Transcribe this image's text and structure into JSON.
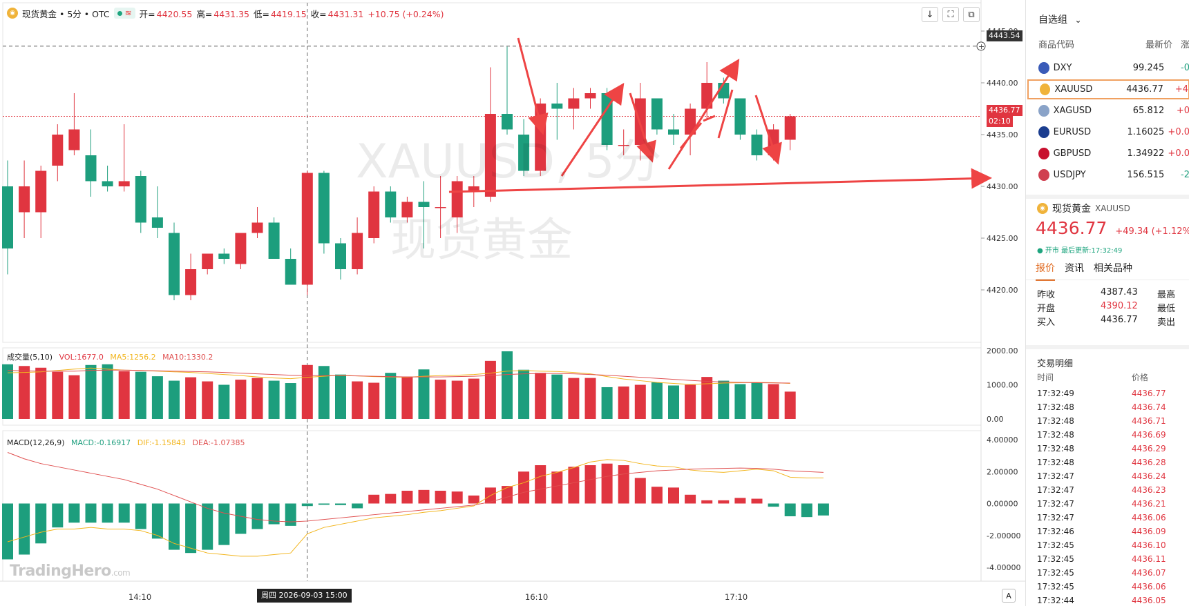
{
  "header": {
    "symbol_title": "现货黄金 • 5分 • OTC",
    "coin_icon": "coin-icon",
    "open_label": "开=",
    "open": "4420.55",
    "high_label": "高=",
    "high": "4431.35",
    "low_label": "低=",
    "low": "4419.15",
    "close_label": "收=",
    "close": "4431.31",
    "change": "+10.75 (+0.24%)"
  },
  "toolbar": {
    "download_icon": "↓",
    "fullscreen_icon": "⛶",
    "screenshot_icon": "⧉"
  },
  "watermark": {
    "symbol": "XAUUSD, 5分",
    "name": "现货黄金",
    "brand": "TradingHero",
    "brand_suffix": ".com"
  },
  "price_axis": {
    "ticks": [
      "4445.00",
      "4440.00",
      "4435.00",
      "4430.00",
      "4425.00",
      "4420.00"
    ],
    "crosshair_value": "4443.54",
    "last_price": "4436.77",
    "countdown": "02:10"
  },
  "volume_pane": {
    "label": "成交量(5,10)",
    "vol": "VOL:1677.0",
    "ma5": "MA5:1256.2",
    "ma10": "MA10:1330.2",
    "ticks": [
      "2000.00",
      "1000.00",
      "0.00"
    ]
  },
  "macd_pane": {
    "label": "MACD(12,26,9)",
    "macd": "MACD:-0.16917",
    "dif": "DIF:-1.15843",
    "dea": "DEA:-1.07385",
    "ticks": [
      "4.00000",
      "2.00000",
      "0.00000",
      "-2.00000",
      "-4.00000"
    ]
  },
  "time_axis": {
    "labels": [
      "14:10",
      "16:10",
      "17:10"
    ],
    "crosshair_date": "周四 2026-09-03  15:00",
    "auto_button": "A"
  },
  "colors": {
    "up": "#e03540",
    "down": "#1d9e7d",
    "ma5": "#f2b51d",
    "ma10": "#e05050",
    "arrow": "#ee4444"
  },
  "chart_data": [
    {
      "type": "candlestick",
      "title": "现货黄金 • 5分 • OTC",
      "ylim": [
        4418,
        4446
      ],
      "candles": [
        {
          "o": 4430.0,
          "h": 4432.5,
          "l": 4421.5,
          "c": 4424.0
        },
        {
          "o": 4427.5,
          "h": 4432.5,
          "l": 4425.0,
          "c": 4430.0
        },
        {
          "o": 4427.5,
          "h": 4432.0,
          "l": 4425.0,
          "c": 4431.5
        },
        {
          "o": 4432.0,
          "h": 4436.0,
          "l": 4430.5,
          "c": 4435.0
        },
        {
          "o": 4433.5,
          "h": 4439.0,
          "l": 4433.0,
          "c": 4435.5
        },
        {
          "o": 4433.0,
          "h": 4435.5,
          "l": 4429.0,
          "c": 4430.5
        },
        {
          "o": 4430.5,
          "h": 4432.0,
          "l": 4429.5,
          "c": 4430.0
        },
        {
          "o": 4430.0,
          "h": 4436.0,
          "l": 4429.5,
          "c": 4430.5
        },
        {
          "o": 4431.0,
          "h": 4431.5,
          "l": 4425.5,
          "c": 4426.5
        },
        {
          "o": 4427.0,
          "h": 4430.0,
          "l": 4425.0,
          "c": 4426.0
        },
        {
          "o": 4425.5,
          "h": 4426.5,
          "l": 4419.0,
          "c": 4419.5
        },
        {
          "o": 4419.5,
          "h": 4423.5,
          "l": 4419.0,
          "c": 4422.0
        },
        {
          "o": 4422.0,
          "h": 4423.5,
          "l": 4421.5,
          "c": 4423.5
        },
        {
          "o": 4423.5,
          "h": 4424.0,
          "l": 4422.5,
          "c": 4423.0
        },
        {
          "o": 4422.5,
          "h": 4425.5,
          "l": 4422.0,
          "c": 4425.5
        },
        {
          "o": 4425.5,
          "h": 4428.0,
          "l": 4425.0,
          "c": 4426.5
        },
        {
          "o": 4426.5,
          "h": 4427.0,
          "l": 4423.0,
          "c": 4423.0
        },
        {
          "o": 4423.0,
          "h": 4424.0,
          "l": 4420.5,
          "c": 4420.5
        },
        {
          "o": 4420.5,
          "h": 4431.5,
          "l": 4419.5,
          "c": 4431.3
        },
        {
          "o": 4431.3,
          "h": 4431.5,
          "l": 4423.5,
          "c": 4424.5
        },
        {
          "o": 4424.5,
          "h": 4425.0,
          "l": 4421.0,
          "c": 4422.0
        },
        {
          "o": 4422.0,
          "h": 4427.0,
          "l": 4421.5,
          "c": 4425.5
        },
        {
          "o": 4425.0,
          "h": 4430.0,
          "l": 4424.5,
          "c": 4429.5
        },
        {
          "o": 4429.5,
          "h": 4430.0,
          "l": 4426.5,
          "c": 4427.0
        },
        {
          "o": 4427.0,
          "h": 4429.0,
          "l": 4426.5,
          "c": 4428.5
        },
        {
          "o": 4428.5,
          "h": 4430.5,
          "l": 4424.0,
          "c": 4428.0
        },
        {
          "o": 4428.0,
          "h": 4431.0,
          "l": 4425.0,
          "c": 4428.0
        },
        {
          "o": 4427.0,
          "h": 4431.0,
          "l": 4425.5,
          "c": 4430.5
        },
        {
          "o": 4429.5,
          "h": 4431.0,
          "l": 4428.0,
          "c": 4430.0
        },
        {
          "o": 4429.0,
          "h": 4441.5,
          "l": 4428.5,
          "c": 4437.0
        },
        {
          "o": 4437.0,
          "h": 4443.5,
          "l": 4435.0,
          "c": 4435.5
        },
        {
          "o": 4435.0,
          "h": 4436.5,
          "l": 4431.0,
          "c": 4431.5
        },
        {
          "o": 4431.5,
          "h": 4438.5,
          "l": 4431.0,
          "c": 4438.0
        },
        {
          "o": 4438.0,
          "h": 4440.0,
          "l": 4434.5,
          "c": 4437.5
        },
        {
          "o": 4437.5,
          "h": 4439.5,
          "l": 4435.5,
          "c": 4438.5
        },
        {
          "o": 4438.5,
          "h": 4439.5,
          "l": 4437.5,
          "c": 4439.0
        },
        {
          "o": 4439.0,
          "h": 4439.5,
          "l": 4433.5,
          "c": 4434.0
        },
        {
          "o": 4434.0,
          "h": 4435.5,
          "l": 4433.0,
          "c": 4434.0
        },
        {
          "o": 4434.0,
          "h": 4440.0,
          "l": 4432.5,
          "c": 4438.5
        },
        {
          "o": 4438.5,
          "h": 4438.5,
          "l": 4435.0,
          "c": 4435.5
        },
        {
          "o": 4435.5,
          "h": 4437.0,
          "l": 4434.0,
          "c": 4435.0
        },
        {
          "o": 4435.0,
          "h": 4438.0,
          "l": 4433.0,
          "c": 4437.5
        },
        {
          "o": 4437.5,
          "h": 4442.0,
          "l": 4436.5,
          "c": 4440.0
        },
        {
          "o": 4440.0,
          "h": 4440.5,
          "l": 4438.0,
          "c": 4438.5
        },
        {
          "o": 4438.5,
          "h": 4438.5,
          "l": 4434.5,
          "c": 4435.0
        },
        {
          "o": 4435.0,
          "h": 4435.5,
          "l": 4432.5,
          "c": 4433.0
        },
        {
          "o": 4433.0,
          "h": 4436.0,
          "l": 4432.5,
          "c": 4435.5
        },
        {
          "o": 4434.5,
          "h": 4437.0,
          "l": 4433.5,
          "c": 4436.77
        }
      ]
    },
    {
      "type": "bar",
      "title": "成交量(5,10)",
      "ylim": [
        0,
        2000
      ],
      "values": [
        1600,
        1550,
        1500,
        1380,
        1280,
        1580,
        1600,
        1400,
        1380,
        1250,
        1120,
        1220,
        1100,
        1000,
        1150,
        1200,
        1120,
        1050,
        1580,
        1550,
        1300,
        1100,
        1060,
        1350,
        1240,
        1450,
        1150,
        1120,
        1180,
        1700,
        1980,
        1440,
        1350,
        1300,
        1200,
        1200,
        930,
        950,
        1000,
        1070,
        980,
        1000,
        1230,
        1120,
        1020,
        1070,
        1020,
        800
      ],
      "ma5": [
        1350,
        1360,
        1380,
        1420,
        1460,
        1490,
        1460,
        1430,
        1420,
        1400,
        1380,
        1360,
        1330,
        1300,
        1270,
        1230,
        1200,
        1180,
        1220,
        1250,
        1280,
        1260,
        1240,
        1230,
        1220,
        1250,
        1270,
        1280,
        1300,
        1340,
        1400,
        1420,
        1400,
        1390,
        1360,
        1320,
        1240,
        1170,
        1120,
        1070,
        1040,
        1010,
        1030,
        1050,
        1060,
        1070,
        1060,
        1040
      ],
      "ma10": [
        1420,
        1410,
        1400,
        1400,
        1400,
        1420,
        1430,
        1430,
        1420,
        1410,
        1400,
        1390,
        1380,
        1360,
        1340,
        1320,
        1300,
        1280,
        1270,
        1270,
        1270,
        1260,
        1250,
        1240,
        1230,
        1230,
        1230,
        1240,
        1250,
        1270,
        1300,
        1320,
        1330,
        1330,
        1320,
        1300,
        1280,
        1250,
        1220,
        1190,
        1160,
        1130,
        1100,
        1080,
        1070,
        1060,
        1055,
        1050
      ]
    },
    {
      "type": "bar",
      "title": "MACD(12,26,9)",
      "ylim": [
        -4,
        4
      ],
      "values": [
        -3.5,
        -3.2,
        -2.5,
        -1.5,
        -1.2,
        -1.2,
        -1.2,
        -1.2,
        -1.6,
        -2.2,
        -2.9,
        -3.1,
        -2.9,
        -2.6,
        -1.9,
        -1.6,
        -1.3,
        -1.4,
        -0.16,
        -0.08,
        -0.1,
        -0.3,
        0.55,
        0.6,
        0.8,
        0.85,
        0.8,
        0.75,
        0.5,
        1.0,
        1.1,
        2.0,
        2.4,
        2.0,
        2.3,
        2.4,
        2.5,
        2.4,
        1.6,
        1.05,
        1.0,
        0.55,
        0.2,
        0.2,
        0.35,
        0.3,
        -0.2,
        -0.8,
        -0.85,
        -0.75
      ],
      "series": [
        {
          "name": "DIF",
          "values": [
            -2.4,
            -2.1,
            -1.8,
            -1.6,
            -1.6,
            -1.5,
            -1.6,
            -1.6,
            -1.7,
            -2.0,
            -2.5,
            -2.8,
            -3.1,
            -3.2,
            -3.3,
            -3.3,
            -3.2,
            -3.1,
            -1.9,
            -1.5,
            -1.3,
            -1.1,
            -0.9,
            -0.8,
            -0.7,
            -0.55,
            -0.45,
            -0.3,
            -0.15,
            0.5,
            1.0,
            1.3,
            1.7,
            1.95,
            2.25,
            2.6,
            2.75,
            2.7,
            2.5,
            2.35,
            2.3,
            2.1,
            2.0,
            1.95,
            2.05,
            2.15,
            2.05,
            1.65,
            1.6,
            1.6
          ]
        },
        {
          "name": "DEA",
          "values": [
            3.2,
            2.8,
            2.5,
            2.3,
            2.1,
            1.9,
            1.7,
            1.5,
            1.2,
            0.9,
            0.5,
            0.1,
            -0.3,
            -0.6,
            -0.8,
            -1.0,
            -1.1,
            -1.15,
            -1.1,
            -1.0,
            -0.9,
            -0.8,
            -0.7,
            -0.6,
            -0.5,
            -0.4,
            -0.3,
            -0.2,
            -0.1,
            0.1,
            0.4,
            0.7,
            0.9,
            1.1,
            1.3,
            1.5,
            1.7,
            1.85,
            1.95,
            2.05,
            2.1,
            2.15,
            2.18,
            2.2,
            2.22,
            2.2,
            2.15,
            2.05,
            2.0,
            1.95
          ]
        }
      ]
    }
  ],
  "annotations": {
    "arrow_count": 9
  },
  "watchlist": {
    "title": "自选组",
    "caret": "⌄",
    "headers": [
      "商品代码",
      "最新价",
      "涨"
    ],
    "rows": [
      {
        "symbol": "DXY",
        "price": "99.245",
        "change": "-0",
        "flag_color": "#3a5bb8",
        "change_color": "#1d9e7d"
      },
      {
        "symbol": "XAUUSD",
        "price": "4436.77",
        "change": "+4",
        "flag_color": "#f0b33a",
        "change_color": "#e03540",
        "selected": true
      },
      {
        "symbol": "XAGUSD",
        "price": "65.812",
        "change": "+0",
        "flag_color": "#8aa3c8",
        "change_color": "#e03540"
      },
      {
        "symbol": "EURUSD",
        "price": "1.16025",
        "change": "+0.0",
        "flag_color": "#1b3d8f",
        "change_color": "#e03540"
      },
      {
        "symbol": "GBPUSD",
        "price": "1.34922",
        "change": "+0.0",
        "flag_color": "#c8102e",
        "change_color": "#e03540"
      },
      {
        "symbol": "USDJPY",
        "price": "156.515",
        "change": "-2",
        "flag_color": "#d04050",
        "change_color": "#1d9e7d"
      }
    ]
  },
  "quote": {
    "name": "现货黄金",
    "code": "XAUUSD",
    "price": "4436.77",
    "change": "+49.34 (+1.12%)",
    "status": "● 开市  最后更新:17:32:49",
    "tabs": [
      "报价",
      "资讯",
      "相关品种"
    ],
    "rows": [
      {
        "k": "昨收",
        "v": "4387.43",
        "k2": "最高"
      },
      {
        "k": "开盘",
        "v": "4390.12",
        "k2": "最低"
      },
      {
        "k": "买入",
        "v": "4436.77",
        "k2": "卖出"
      }
    ]
  },
  "trades": {
    "title": "交易明细",
    "headers": [
      "时间",
      "价格"
    ],
    "rows": [
      {
        "t": "17:32:49",
        "p": "4436.77"
      },
      {
        "t": "17:32:48",
        "p": "4436.74"
      },
      {
        "t": "17:32:48",
        "p": "4436.71"
      },
      {
        "t": "17:32:48",
        "p": "4436.69"
      },
      {
        "t": "17:32:48",
        "p": "4436.29"
      },
      {
        "t": "17:32:48",
        "p": "4436.28"
      },
      {
        "t": "17:32:47",
        "p": "4436.24"
      },
      {
        "t": "17:32:47",
        "p": "4436.23"
      },
      {
        "t": "17:32:47",
        "p": "4436.21"
      },
      {
        "t": "17:32:47",
        "p": "4436.06"
      },
      {
        "t": "17:32:46",
        "p": "4436.09"
      },
      {
        "t": "17:32:45",
        "p": "4436.10"
      },
      {
        "t": "17:32:45",
        "p": "4436.11"
      },
      {
        "t": "17:32:45",
        "p": "4436.07"
      },
      {
        "t": "17:32:45",
        "p": "4436.06"
      },
      {
        "t": "17:32:44",
        "p": "4436.05"
      }
    ]
  }
}
